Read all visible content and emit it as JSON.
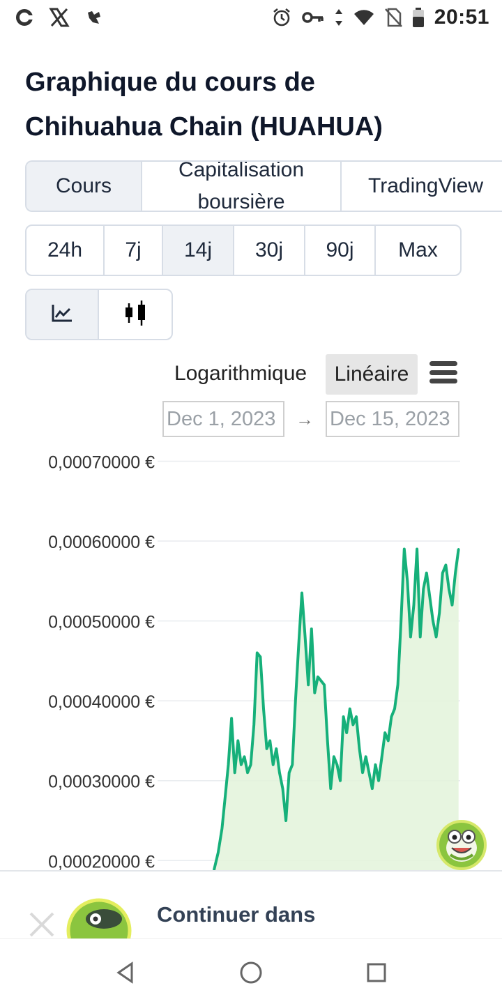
{
  "status_bar": {
    "time": "20:51",
    "left_icons": [
      "app-c-icon",
      "x-logo-icon",
      "app-bird-icon"
    ],
    "right_icons": [
      "alarm-icon",
      "key-icon",
      "data-arrows-icon",
      "wifi-icon",
      "no-sim-icon",
      "battery-icon"
    ]
  },
  "page": {
    "title_line1": "Graphique du cours de",
    "title_line2": "Chihuahua Chain (HUAHUA)"
  },
  "tabs": [
    {
      "label": "Cours",
      "active": true
    },
    {
      "label_line1": "Capitalisation",
      "label_line2": "boursière",
      "active": false
    },
    {
      "label": "TradingView",
      "active": false
    }
  ],
  "ranges": [
    {
      "label": "24h",
      "active": false
    },
    {
      "label": "7j",
      "active": false
    },
    {
      "label": "14j",
      "active": true
    },
    {
      "label": "30j",
      "active": false
    },
    {
      "label": "90j",
      "active": false
    },
    {
      "label": "Max",
      "active": false
    }
  ],
  "chart_types": [
    {
      "icon": "line-chart-icon",
      "active": true
    },
    {
      "icon": "candlestick-icon",
      "active": false
    }
  ],
  "scale": {
    "log_label": "Logarithmique",
    "linear_label": "Linéaire",
    "selected": "Linéaire"
  },
  "date_range": {
    "from": "Dec 1, 2023",
    "arrow": "→",
    "to": "Dec 15, 2023"
  },
  "chart_data": {
    "type": "area",
    "title": "",
    "xlabel": "",
    "ylabel": "",
    "y_tick_labels": [
      "0,00070000 €",
      "0,00060000 €",
      "0,00050000 €",
      "0,00040000 €",
      "0,00030000 €",
      "0,00020000 €"
    ],
    "y_ticks": [
      0.0007,
      0.0006,
      0.0005,
      0.0004,
      0.0003,
      0.0002
    ],
    "ylim": [
      0.000188,
      0.00071
    ],
    "x_range": [
      0,
      14
    ],
    "grid": true,
    "colors": {
      "line": "#16b07a",
      "fill": "#e3f3da",
      "grid": "#e9ecef"
    },
    "series": [
      {
        "x": [
          6.3,
          6.43,
          6.55,
          6.65,
          6.75,
          6.85,
          6.95,
          7.05,
          7.15,
          7.25,
          7.35,
          7.45,
          7.55,
          7.65,
          7.75,
          7.85,
          7.95,
          8.05,
          8.15,
          8.25,
          8.35,
          8.45,
          8.55,
          8.65,
          8.75,
          8.85,
          8.95,
          9.05,
          9.15,
          9.25,
          9.35,
          9.45,
          9.55,
          9.65,
          9.75,
          9.85,
          9.95,
          10.05,
          10.15,
          10.25,
          10.35,
          10.45,
          10.55,
          10.65,
          10.75,
          10.85,
          10.95,
          11.05,
          11.15,
          11.25,
          11.35,
          11.45,
          11.55,
          11.65,
          11.75,
          11.85,
          11.95,
          12.05,
          12.15,
          12.25,
          12.35,
          12.45,
          12.55,
          12.65,
          12.75,
          12.85,
          12.95,
          13.05,
          13.15,
          13.25,
          13.35,
          13.45,
          13.55,
          13.65,
          13.75,
          13.85,
          13.95
        ],
        "values": [
          0.000188,
          0.00021,
          0.00024,
          0.00028,
          0.00032,
          0.000378,
          0.00031,
          0.00035,
          0.00032,
          0.00033,
          0.00031,
          0.00032,
          0.00037,
          0.00046,
          0.000455,
          0.00039,
          0.00034,
          0.00035,
          0.00032,
          0.00034,
          0.00031,
          0.00029,
          0.00025,
          0.00031,
          0.00032,
          0.0004,
          0.00047,
          0.000535,
          0.00048,
          0.00042,
          0.00049,
          0.00041,
          0.00043,
          0.000425,
          0.00042,
          0.00035,
          0.00029,
          0.00033,
          0.00032,
          0.0003,
          0.00038,
          0.00036,
          0.00039,
          0.00037,
          0.00038,
          0.00034,
          0.00031,
          0.00033,
          0.00031,
          0.00029,
          0.00032,
          0.0003,
          0.00033,
          0.00036,
          0.00035,
          0.00038,
          0.00039,
          0.00042,
          0.0005,
          0.00059,
          0.00055,
          0.00048,
          0.00052,
          0.00059,
          0.00048,
          0.00054,
          0.00056,
          0.00053,
          0.0005,
          0.00048,
          0.00051,
          0.00056,
          0.00057,
          0.00054,
          0.00052,
          0.00056,
          0.00059
        ]
      }
    ]
  },
  "banner": {
    "text": "Continuer dans"
  },
  "nav_bar": {
    "icons": [
      "back-triangle-icon",
      "home-circle-icon",
      "recents-square-icon"
    ]
  }
}
